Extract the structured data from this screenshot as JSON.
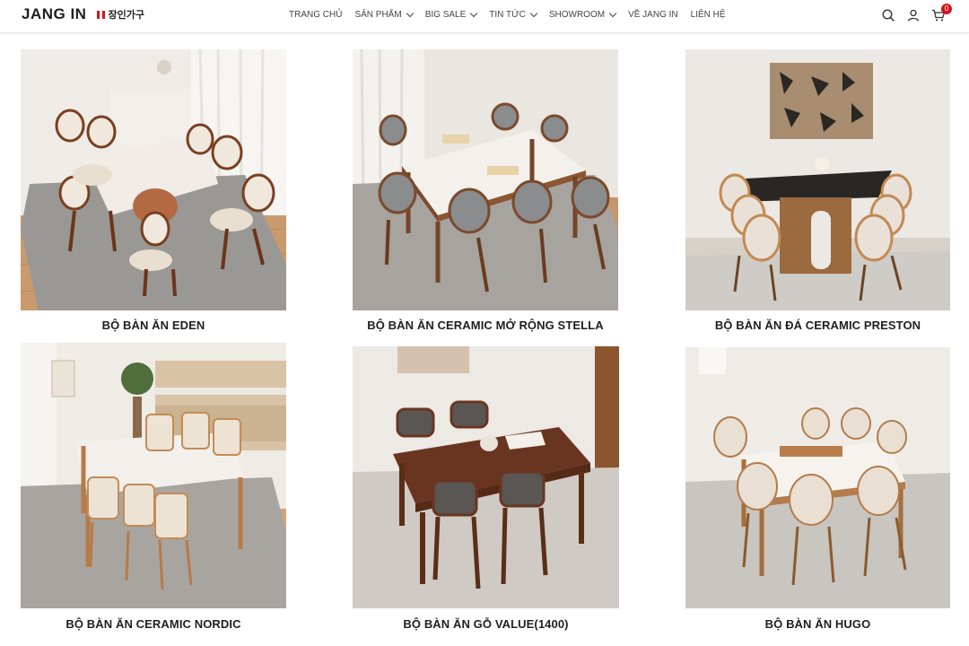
{
  "brand": {
    "logo_text": "JANG IN",
    "logo_korean": "장인가구"
  },
  "nav": {
    "items": [
      {
        "label": "TRANG CHỦ",
        "has_dropdown": false
      },
      {
        "label": "SẢN PHẨM",
        "has_dropdown": true
      },
      {
        "label": "BIG SALE",
        "has_dropdown": true
      },
      {
        "label": "TIN TỨC",
        "has_dropdown": true
      },
      {
        "label": "SHOWROOM",
        "has_dropdown": true
      },
      {
        "label": "VỀ JANG IN",
        "has_dropdown": false
      },
      {
        "label": "LIÊN HỆ",
        "has_dropdown": false
      }
    ]
  },
  "tools": {
    "search_icon": "search-icon",
    "account_icon": "user-icon",
    "cart_icon": "cart-icon",
    "cart_count": "0"
  },
  "colors": {
    "accent": "#d3141b",
    "text": "#1f1f1f"
  },
  "products": [
    {
      "name": "BỘ BÀN ĂN EDEN",
      "image": "eden-dining-set"
    },
    {
      "name": "BỘ BÀN ĂN CERAMIC MỞ RỘNG STELLA",
      "image": "stella-dining-set"
    },
    {
      "name": "BỘ BÀN ĂN ĐÁ CERAMIC PRESTON",
      "image": "preston-dining-set"
    },
    {
      "name": "BỘ BÀN ĂN CERAMIC NORDIC",
      "image": "nordic-dining-set"
    },
    {
      "name": "BỘ BÀN ĂN GỖ VALUE(1400)",
      "image": "value-dining-set"
    },
    {
      "name": "BỘ BÀN ĂN HUGO",
      "image": "hugo-dining-set"
    }
  ]
}
